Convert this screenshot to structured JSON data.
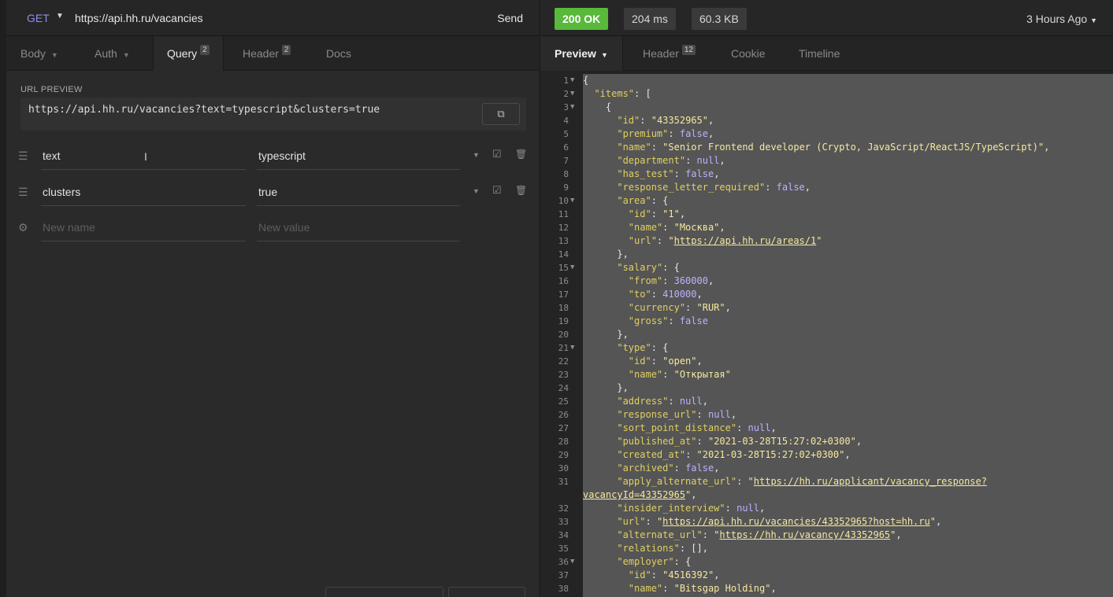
{
  "request": {
    "method": "GET",
    "url": "https://api.hh.ru/vacancies",
    "send_label": "Send"
  },
  "request_tabs": [
    {
      "label": "Body",
      "badge": ""
    },
    {
      "label": "Auth",
      "badge": ""
    },
    {
      "label": "Query",
      "badge": "2"
    },
    {
      "label": "Header",
      "badge": "2"
    },
    {
      "label": "Docs",
      "badge": ""
    }
  ],
  "query": {
    "url_preview_label": "URL PREVIEW",
    "url_preview": "https://api.hh.ru/vacancies?text=typescript&clusters=true",
    "params": [
      {
        "name": "text",
        "value": "typescript"
      },
      {
        "name": "clusters",
        "value": "true"
      }
    ],
    "new_name_placeholder": "New name",
    "new_value_placeholder": "New value"
  },
  "response": {
    "status": "200 OK",
    "time": "204 ms",
    "size": "60.3 KB",
    "time_ago": "3 Hours Ago"
  },
  "response_tabs": [
    {
      "label": "Preview",
      "badge": ""
    },
    {
      "label": "Header",
      "badge": "12"
    },
    {
      "label": "Cookie",
      "badge": ""
    },
    {
      "label": "Timeline",
      "badge": ""
    }
  ],
  "colors": {
    "status_ok": "#58b93a",
    "method": "#8f8cf0",
    "json_key": "#e0d060",
    "json_literal": "#bdb0ff"
  },
  "code_lines": [
    {
      "n": "1",
      "fold": true,
      "html": "<span class='p'>{</span>"
    },
    {
      "n": "2",
      "fold": true,
      "html": "  <span class='k'>\"items\"</span><span class='p'>: [</span>"
    },
    {
      "n": "3",
      "fold": true,
      "html": "    <span class='p'>{</span>"
    },
    {
      "n": "4",
      "fold": false,
      "html": "      <span class='k'>\"id\"</span><span class='p'>: </span><span class='s'>\"43352965\"</span><span class='p'>,</span>"
    },
    {
      "n": "5",
      "fold": false,
      "html": "      <span class='k'>\"premium\"</span><span class='p'>: </span><span class='kw'>false</span><span class='p'>,</span>"
    },
    {
      "n": "6",
      "fold": false,
      "html": "      <span class='k'>\"name\"</span><span class='p'>: </span><span class='s'>\"Senior Frontend developer (Crypto, JavaScript/ReactJS/TypeScript)\"</span><span class='p'>,</span>"
    },
    {
      "n": "7",
      "fold": false,
      "html": "      <span class='k'>\"department\"</span><span class='p'>: </span><span class='kw'>null</span><span class='p'>,</span>"
    },
    {
      "n": "8",
      "fold": false,
      "html": "      <span class='k'>\"has_test\"</span><span class='p'>: </span><span class='kw'>false</span><span class='p'>,</span>"
    },
    {
      "n": "9",
      "fold": false,
      "html": "      <span class='k'>\"response_letter_required\"</span><span class='p'>: </span><span class='kw'>false</span><span class='p'>,</span>"
    },
    {
      "n": "10",
      "fold": true,
      "html": "      <span class='k'>\"area\"</span><span class='p'>: {</span>"
    },
    {
      "n": "11",
      "fold": false,
      "html": "        <span class='k'>\"id\"</span><span class='p'>: </span><span class='s'>\"1\"</span><span class='p'>,</span>"
    },
    {
      "n": "12",
      "fold": false,
      "html": "        <span class='k'>\"name\"</span><span class='p'>: </span><span class='s'>\"Москва\"</span><span class='p'>,</span>"
    },
    {
      "n": "13",
      "fold": false,
      "html": "        <span class='k'>\"url\"</span><span class='p'>: </span><span class='s'>\"</span><span class='u'>https://api.hh.ru/areas/1</span><span class='s'>\"</span>"
    },
    {
      "n": "14",
      "fold": false,
      "html": "      <span class='p'>},</span>"
    },
    {
      "n": "15",
      "fold": true,
      "html": "      <span class='k'>\"salary\"</span><span class='p'>: {</span>"
    },
    {
      "n": "16",
      "fold": false,
      "html": "        <span class='k'>\"from\"</span><span class='p'>: </span><span class='n'>360000</span><span class='p'>,</span>"
    },
    {
      "n": "17",
      "fold": false,
      "html": "        <span class='k'>\"to\"</span><span class='p'>: </span><span class='n'>410000</span><span class='p'>,</span>"
    },
    {
      "n": "18",
      "fold": false,
      "html": "        <span class='k'>\"currency\"</span><span class='p'>: </span><span class='s'>\"RUR\"</span><span class='p'>,</span>"
    },
    {
      "n": "19",
      "fold": false,
      "html": "        <span class='k'>\"gross\"</span><span class='p'>: </span><span class='kw'>false</span>"
    },
    {
      "n": "20",
      "fold": false,
      "html": "      <span class='p'>},</span>"
    },
    {
      "n": "21",
      "fold": true,
      "html": "      <span class='k'>\"type\"</span><span class='p'>: {</span>"
    },
    {
      "n": "22",
      "fold": false,
      "html": "        <span class='k'>\"id\"</span><span class='p'>: </span><span class='s'>\"open\"</span><span class='p'>,</span>"
    },
    {
      "n": "23",
      "fold": false,
      "html": "        <span class='k'>\"name\"</span><span class='p'>: </span><span class='s'>\"Открытая\"</span>"
    },
    {
      "n": "24",
      "fold": false,
      "html": "      <span class='p'>},</span>"
    },
    {
      "n": "25",
      "fold": false,
      "html": "      <span class='k'>\"address\"</span><span class='p'>: </span><span class='kw'>null</span><span class='p'>,</span>"
    },
    {
      "n": "26",
      "fold": false,
      "html": "      <span class='k'>\"response_url\"</span><span class='p'>: </span><span class='kw'>null</span><span class='p'>,</span>"
    },
    {
      "n": "27",
      "fold": false,
      "html": "      <span class='k'>\"sort_point_distance\"</span><span class='p'>: </span><span class='kw'>null</span><span class='p'>,</span>"
    },
    {
      "n": "28",
      "fold": false,
      "html": "      <span class='k'>\"published_at\"</span><span class='p'>: </span><span class='s'>\"2021-03-28T15:27:02+0300\"</span><span class='p'>,</span>"
    },
    {
      "n": "29",
      "fold": false,
      "html": "      <span class='k'>\"created_at\"</span><span class='p'>: </span><span class='s'>\"2021-03-28T15:27:02+0300\"</span><span class='p'>,</span>"
    },
    {
      "n": "30",
      "fold": false,
      "html": "      <span class='k'>\"archived\"</span><span class='p'>: </span><span class='kw'>false</span><span class='p'>,</span>"
    },
    {
      "n": "31",
      "fold": false,
      "html": "      <span class='k'>\"apply_alternate_url\"</span><span class='p'>: </span><span class='s'>\"</span><span class='u'>https://hh.ru/applicant/vacancy_response?</span>"
    },
    {
      "n": "",
      "fold": false,
      "html": "<span class='u'>vacancyId=43352965</span><span class='s'>\"</span><span class='p'>,</span>"
    },
    {
      "n": "32",
      "fold": false,
      "html": "      <span class='k'>\"insider_interview\"</span><span class='p'>: </span><span class='kw'>null</span><span class='p'>,</span>"
    },
    {
      "n": "33",
      "fold": false,
      "html": "      <span class='k'>\"url\"</span><span class='p'>: </span><span class='s'>\"</span><span class='u'>https://api.hh.ru/vacancies/43352965?host=hh.ru</span><span class='s'>\"</span><span class='p'>,</span>"
    },
    {
      "n": "34",
      "fold": false,
      "html": "      <span class='k'>\"alternate_url\"</span><span class='p'>: </span><span class='s'>\"</span><span class='u'>https://hh.ru/vacancy/43352965</span><span class='s'>\"</span><span class='p'>,</span>"
    },
    {
      "n": "35",
      "fold": false,
      "html": "      <span class='k'>\"relations\"</span><span class='p'>: [],</span>"
    },
    {
      "n": "36",
      "fold": true,
      "html": "      <span class='k'>\"employer\"</span><span class='p'>: {</span>"
    },
    {
      "n": "37",
      "fold": false,
      "html": "        <span class='k'>\"id\"</span><span class='p'>: </span><span class='s'>\"4516392\"</span><span class='p'>,</span>"
    },
    {
      "n": "38",
      "fold": false,
      "html": "        <span class='k'>\"name\"</span><span class='p'>: </span><span class='s'>\"Bitsgap Holding\"</span><span class='p'>,</span>"
    }
  ]
}
